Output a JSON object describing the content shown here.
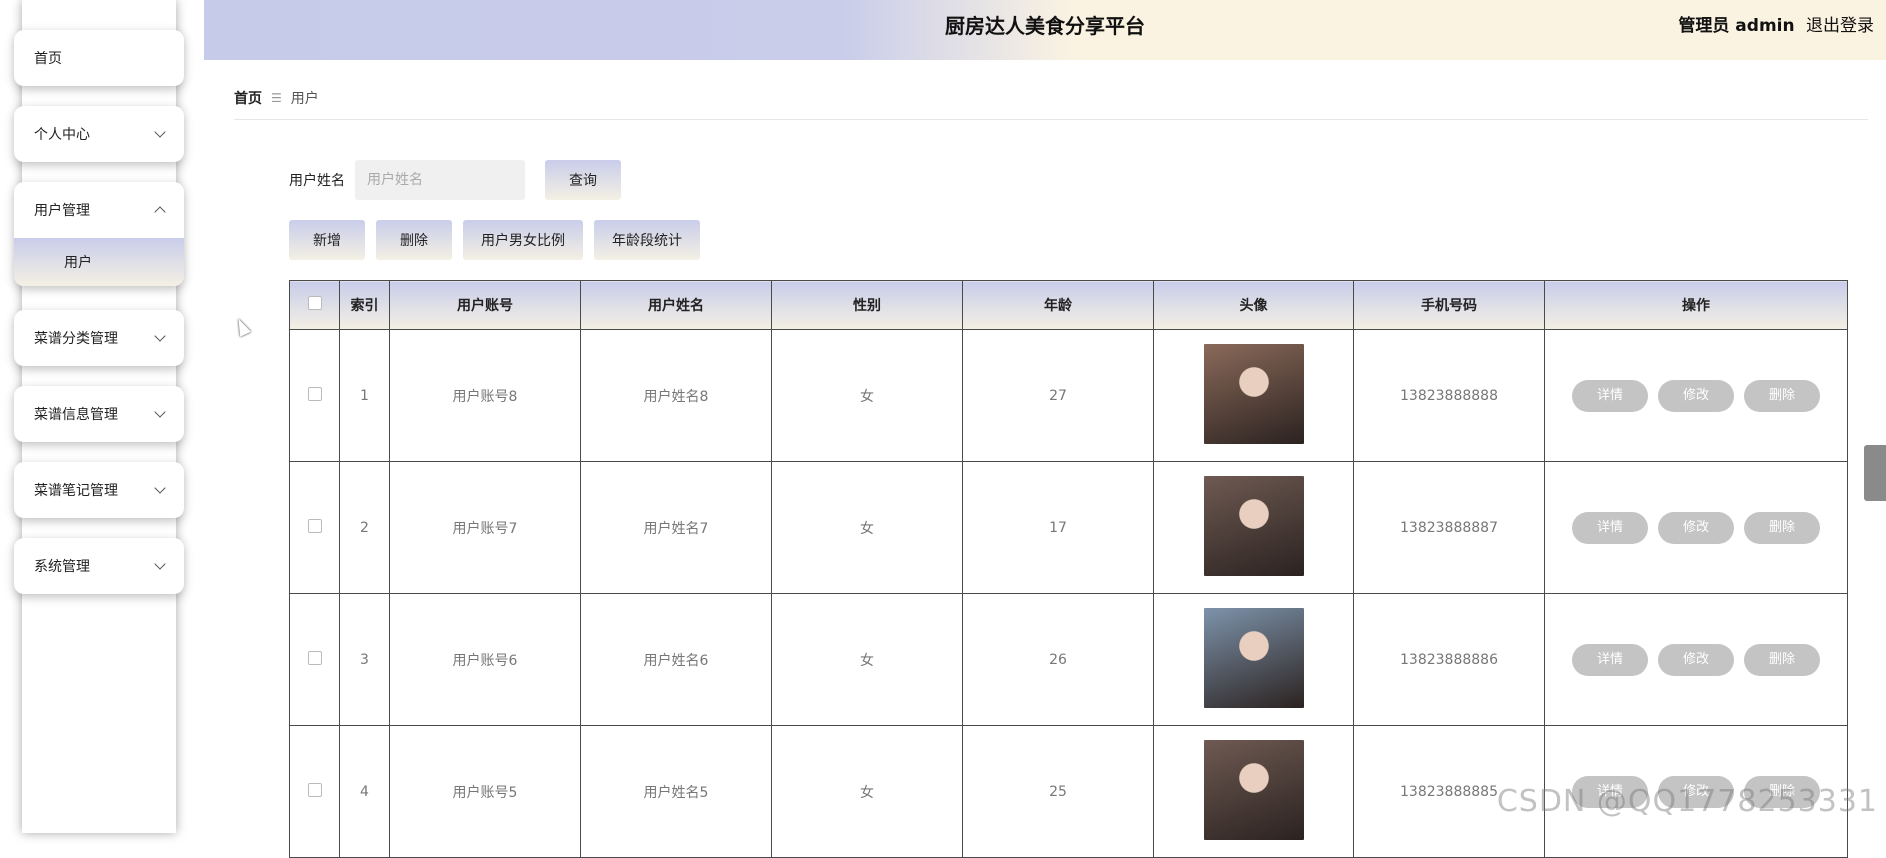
{
  "app": {
    "title": "厨房达人美食分享平台"
  },
  "header": {
    "role_label": "管理员 admin",
    "logout_label": "退出登录"
  },
  "sidebar": {
    "items": [
      {
        "label": "首页",
        "expandable": false
      },
      {
        "label": "个人中心",
        "expandable": true
      },
      {
        "label": "用户管理",
        "expandable": true,
        "expanded": true,
        "children": [
          "用户"
        ]
      },
      {
        "label": "菜谱分类管理",
        "expandable": true
      },
      {
        "label": "菜谱信息管理",
        "expandable": true
      },
      {
        "label": "菜谱笔记管理",
        "expandable": true
      },
      {
        "label": "系统管理",
        "expandable": true
      }
    ]
  },
  "breadcrumb": {
    "home": "首页",
    "current": "用户"
  },
  "search": {
    "label": "用户姓名",
    "placeholder": "用户姓名",
    "value": "",
    "button": "查询"
  },
  "actions": {
    "add": "新增",
    "delete": "删除",
    "gender_ratio": "用户男女比例",
    "age_stats": "年龄段统计"
  },
  "table": {
    "headers": [
      "索引",
      "用户账号",
      "用户姓名",
      "性别",
      "年龄",
      "头像",
      "手机号码",
      "操作"
    ],
    "row_actions": {
      "detail": "详情",
      "edit": "修改",
      "delete": "删除"
    },
    "rows": [
      {
        "index": "1",
        "account": "用户账号8",
        "name": "用户姓名8",
        "gender": "女",
        "age": "27",
        "phone": "13823888888",
        "avatar_color": "#8a6a5a"
      },
      {
        "index": "2",
        "account": "用户账号7",
        "name": "用户姓名7",
        "gender": "女",
        "age": "17",
        "phone": "13823888887",
        "avatar_color": "#6e5a52"
      },
      {
        "index": "3",
        "account": "用户账号6",
        "name": "用户姓名6",
        "gender": "女",
        "age": "26",
        "phone": "13823888886",
        "avatar_color": "#7d93ab"
      },
      {
        "index": "4",
        "account": "用户账号5",
        "name": "用户姓名5",
        "gender": "女",
        "age": "25",
        "phone": "13823888885",
        "avatar_color": "#6e5a52"
      }
    ]
  },
  "watermark": "CSDN @QQ1778253331",
  "colors": {
    "accent_start": "#c9cdea",
    "accent_end": "#f4f0e4",
    "row_button": "#c4c4c4"
  }
}
